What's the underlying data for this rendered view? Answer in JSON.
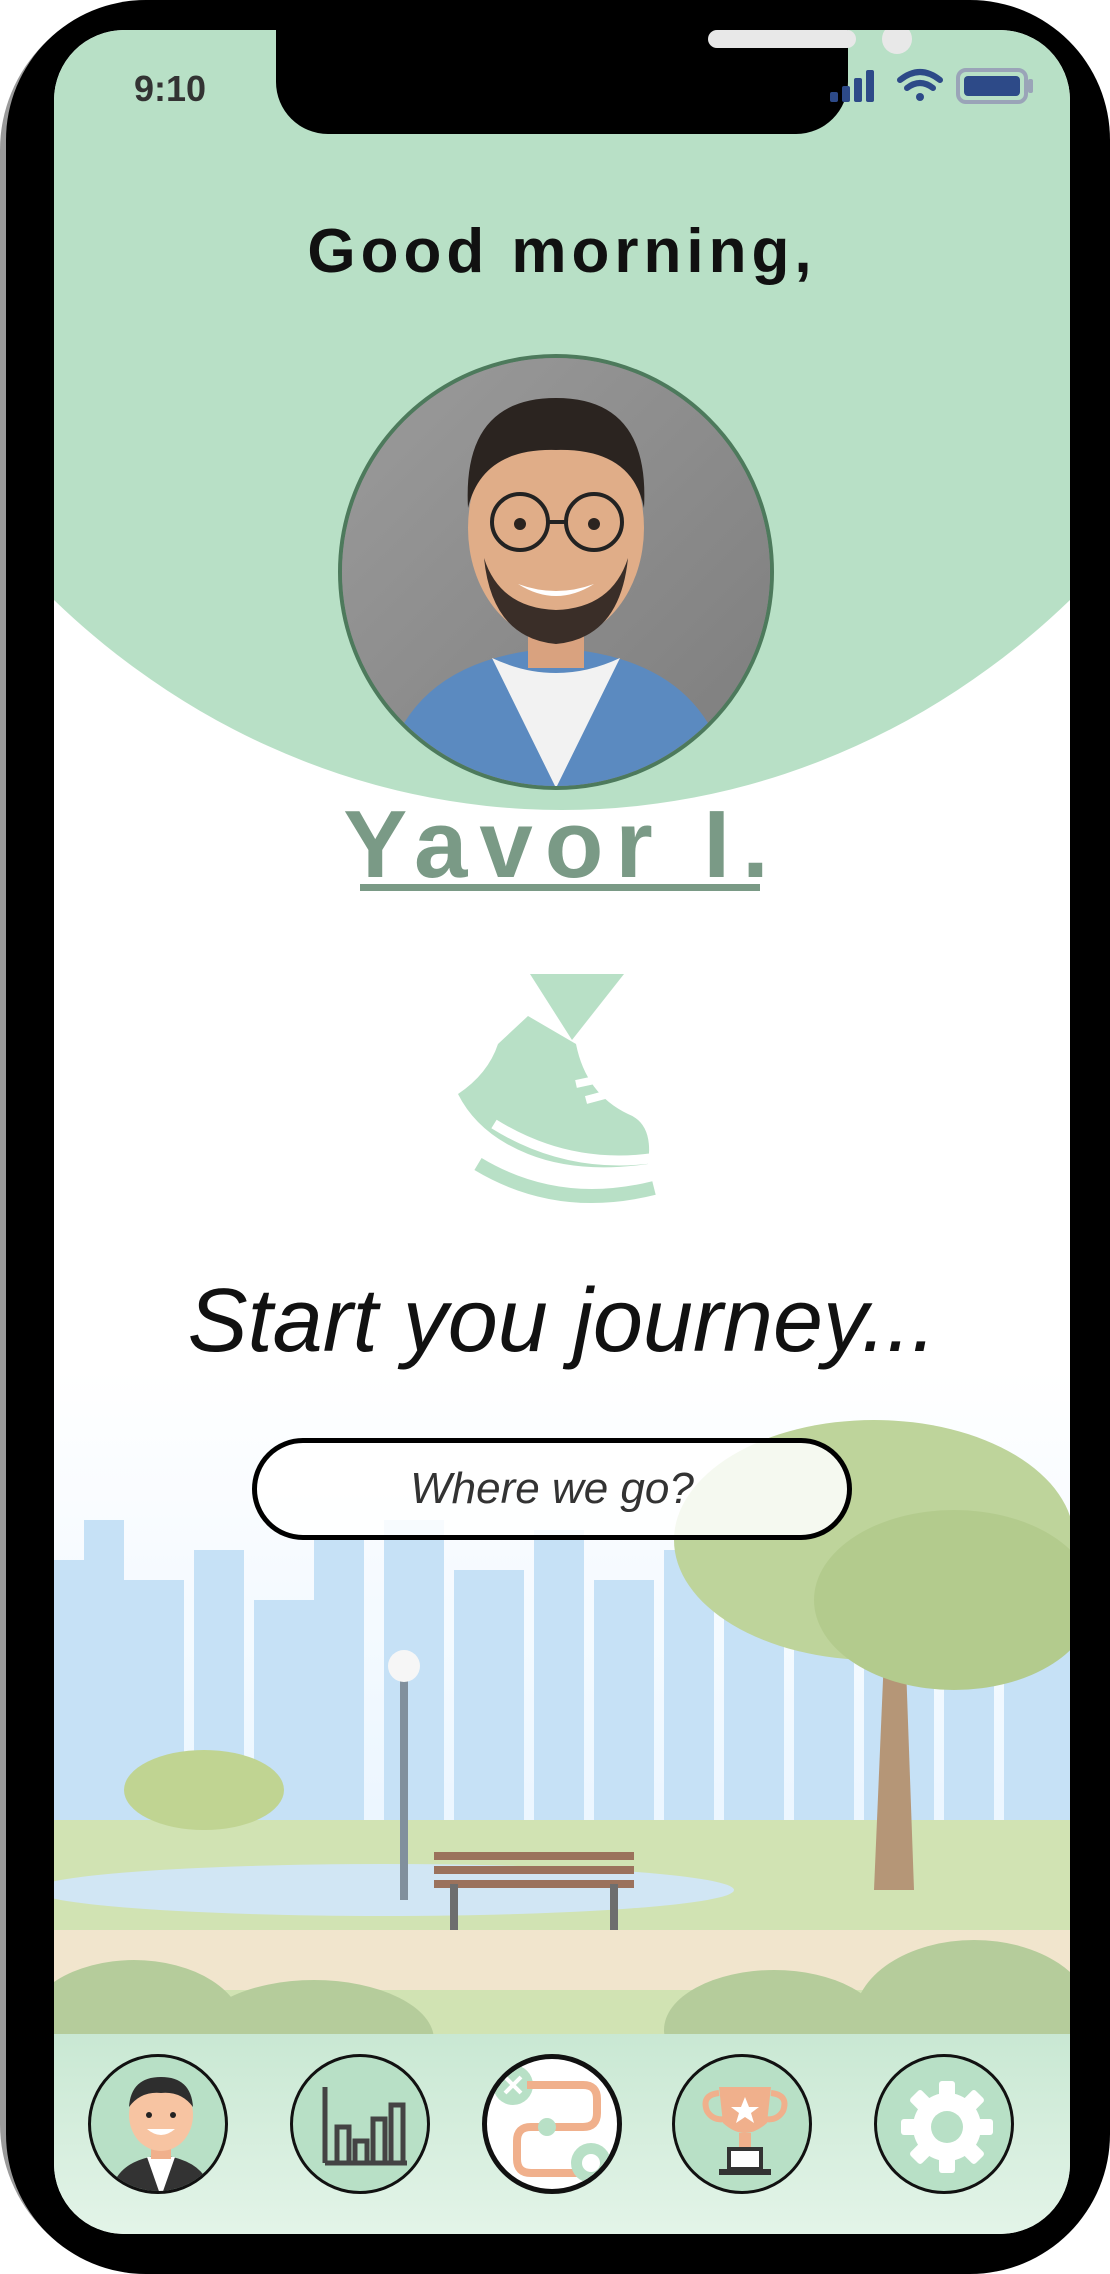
{
  "status_bar": {
    "time": "9:10",
    "icons": [
      "signal-icon",
      "wifi-icon",
      "battery-icon"
    ]
  },
  "header": {
    "greeting": "Good morning,"
  },
  "profile": {
    "name": "Yavor I.",
    "avatar": "profile-photo"
  },
  "main": {
    "hero_icon": "shoe-icon",
    "tagline": "Start you journey...",
    "search": {
      "placeholder": "Where we go?",
      "value": ""
    },
    "background": "park-illustration"
  },
  "tab_bar": {
    "items": [
      {
        "icon": "person-avatar-icon",
        "selected": false
      },
      {
        "icon": "bar-chart-icon",
        "selected": false
      },
      {
        "icon": "route-icon",
        "selected": true
      },
      {
        "icon": "trophy-icon",
        "selected": false
      },
      {
        "icon": "gear-icon",
        "selected": false
      }
    ]
  },
  "colors": {
    "accent_green": "#b8e0c6",
    "name_green": "#7a9a86",
    "avatar_border": "#4d7a5c"
  }
}
